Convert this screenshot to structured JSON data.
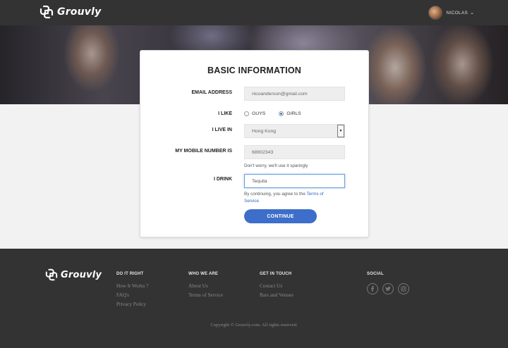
{
  "header": {
    "brand": "Grouvly",
    "user_name": "NICOLAS",
    "chevron": "chevron-down-icon"
  },
  "form": {
    "title": "BASIC INFORMATION",
    "email_label": "EMAIL ADDRESS",
    "email_value": "nicoanderson@gmail.com",
    "like_label": "I LIKE",
    "like_options": [
      "GUYS",
      "GIRLS"
    ],
    "like_selected": "GIRLS",
    "live_label": "I LIVE IN",
    "live_value": "Hong Kong",
    "mobile_label": "MY MOBILE NUMBER IS",
    "mobile_value": "68902343",
    "mobile_hint": "Don't worry, we'll use it sparingly",
    "drink_label": "I DRINK",
    "drink_value": "Tequila",
    "terms_prefix": "By continuing, you agree to the",
    "terms_link": "Terms of Service",
    "continue_label": "CONTINUE",
    "accent_color": "#3d6ec9"
  },
  "footer": {
    "brand": "Grouvly",
    "columns": [
      {
        "heading": "DO IT RIGHT",
        "links": [
          "How It Works ?",
          "FAQ's",
          "Privacy Policy"
        ]
      },
      {
        "heading": "WHO WE ARE",
        "links": [
          "About Us",
          "Terms of Service"
        ]
      },
      {
        "heading": "GET IN TOUCH",
        "links": [
          "Contact Us",
          "Bars and Venues"
        ]
      }
    ],
    "social_heading": "SOCIAL",
    "social_icons": [
      "facebook-icon",
      "twitter-icon",
      "instagram-icon"
    ],
    "copyright": "Copyright © Grouvly.com. All rights reserved."
  }
}
